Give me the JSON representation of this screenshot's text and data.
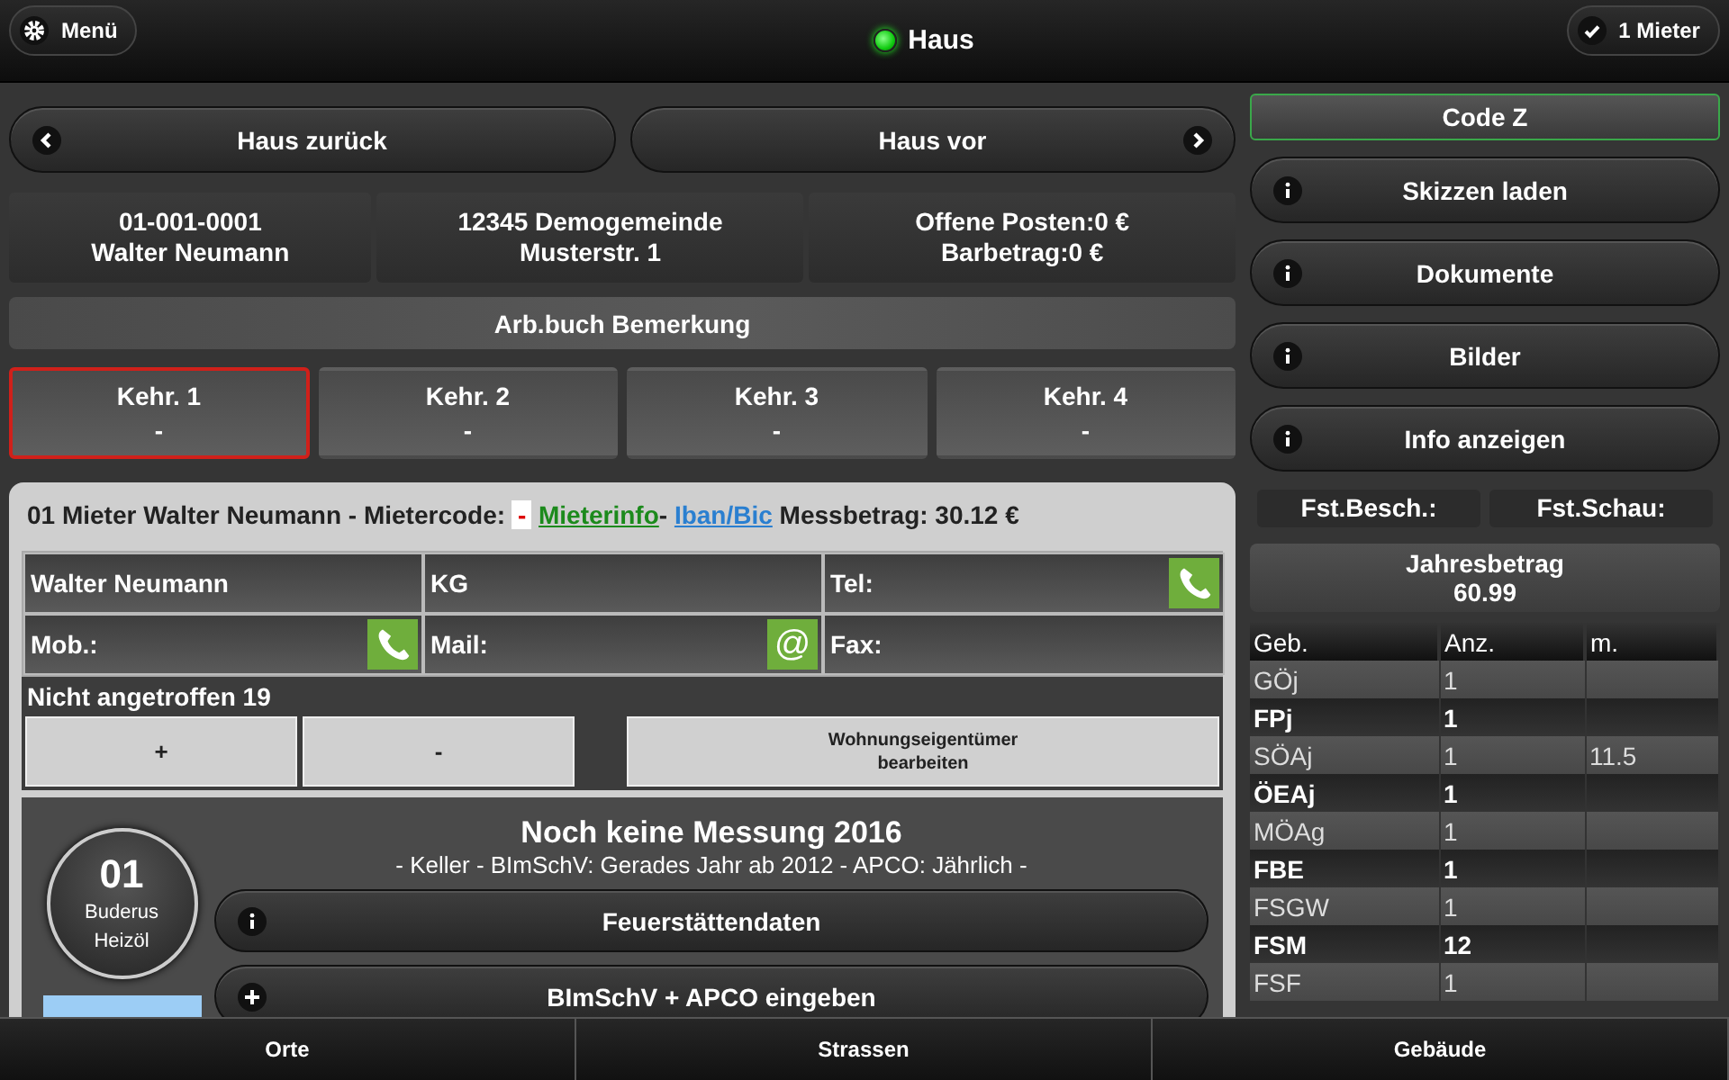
{
  "header": {
    "menu_button": "Menü",
    "title": "Haus",
    "status_online": true,
    "tenant_button": "1 Mieter"
  },
  "nav": [
    {
      "label": "Haus zurück",
      "kind": "prev"
    },
    {
      "label": "Haus vor",
      "kind": "next"
    }
  ],
  "info_cells": [
    {
      "lines": [
        "01-001-0001",
        "Walter Neumann"
      ]
    },
    {
      "lines": [
        "12345 Demogemeinde",
        "Musterstr. 1"
      ]
    },
    {
      "lines": [
        "Offene Posten:0 €",
        "Barbetrag:0 €"
      ]
    }
  ],
  "remark_button": "Arb.buch Bemerkung",
  "sweeps": [
    {
      "label": "Kehr. 1",
      "value": "-",
      "selected": true
    },
    {
      "label": "Kehr. 2",
      "value": "-",
      "selected": false
    },
    {
      "label": "Kehr. 3",
      "value": "-",
      "selected": false
    },
    {
      "label": "Kehr. 4",
      "value": "-",
      "selected": false
    }
  ],
  "tenant": {
    "heading": "01 Mieter Walter Neumann - Mietercode:",
    "code": "-",
    "info_link": "Mieterinfo",
    "separator": "-",
    "iban_link": "Iban/Bic",
    "amount": "Messbetrag: 30.12 €",
    "contact_cells": [
      {
        "text": "Walter Neumann"
      },
      {
        "text": "KG"
      },
      {
        "text": "Tel:",
        "kind": "phone"
      },
      {
        "text": "Mob.:",
        "kind": "phone"
      },
      {
        "text": "Mail:",
        "kind": "mail",
        "symbol": "@"
      },
      {
        "text": "Fax:"
      }
    ],
    "absent_label": "Nicht angetroffen 19",
    "absent_buttons": [
      "+",
      "-"
    ],
    "owner_button": [
      "Wohnungseigentümer",
      "bearbeiten"
    ]
  },
  "fireplace": {
    "number": "01",
    "brand": "Buderus",
    "fuel": "Heizöl",
    "title": "Noch keine Messung 2016",
    "subtitle": "- Keller - BImSchV: Gerades Jahr ab 2012 - APCO: Jährlich -",
    "buttons": [
      {
        "label": "Feuerstättendaten",
        "kind": "info"
      },
      {
        "label": "BImSchV + APCO eingeben",
        "kind": "add"
      }
    ]
  },
  "sidebar": {
    "code_button": "Code Z",
    "buttons": [
      "Skizzen laden",
      "Dokumente",
      "Bilder",
      "Info anzeigen"
    ],
    "labels": [
      "Fst.Besch.:",
      "Fst.Schau:"
    ],
    "annual": [
      "Jahresbetrag",
      "60.99"
    ],
    "table": {
      "columns": [
        "Geb.",
        "Anz.",
        "m."
      ],
      "rows": [
        {
          "cells": [
            "GÖj",
            "1",
            ""
          ],
          "emphasized": false
        },
        {
          "cells": [
            "FPj",
            "1",
            ""
          ],
          "emphasized": true
        },
        {
          "cells": [
            "SÖAj",
            "1",
            "11.5"
          ],
          "emphasized": false
        },
        {
          "cells": [
            "ÖEAj",
            "1",
            ""
          ],
          "emphasized": true
        },
        {
          "cells": [
            "MÖAg",
            "1",
            ""
          ],
          "emphasized": false
        },
        {
          "cells": [
            "FBE",
            "1",
            ""
          ],
          "emphasized": true
        },
        {
          "cells": [
            "FSGW",
            "1",
            ""
          ],
          "emphasized": false
        },
        {
          "cells": [
            "FSM",
            "12",
            ""
          ],
          "emphasized": true
        },
        {
          "cells": [
            "FSF",
            "1",
            ""
          ],
          "emphasized": false
        }
      ]
    }
  },
  "footer": [
    {
      "label": "Orte",
      "selected": false
    },
    {
      "label": "Strassen",
      "selected": false
    },
    {
      "label": "Gebäude",
      "selected": false
    }
  ]
}
